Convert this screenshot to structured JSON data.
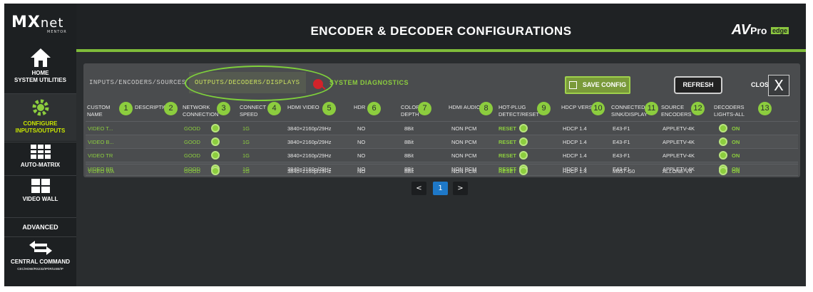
{
  "brand": {
    "logo_main": "MX",
    "logo_net": "net",
    "logo_sub": "MENTOR",
    "vendor": "AV",
    "vendor_pro": "Pro",
    "vendor_edge": "edge"
  },
  "title": "ENCODER & DECODER CONFIGURATIONS",
  "sidebar": {
    "items": [
      {
        "label": "HOME",
        "sub": "SYSTEM UTILITIES",
        "icon": "home-icon"
      },
      {
        "label": "CONFIGURE",
        "sub": "INPUTS/OUTPUTS",
        "icon": "gear-icon"
      },
      {
        "label": "AUTO-MATRIX",
        "icon": "matrix-grid-icon"
      },
      {
        "label": "VIDEO WALL",
        "icon": "video-wall-icon"
      },
      {
        "label": "ADVANCED"
      },
      {
        "label": "CENTRAL COMMAND",
        "sub": "CEC/HDMI/RS232/IP/IR/USB/IP",
        "icon": "arrows-icon"
      }
    ]
  },
  "tabs": [
    "INPUTS/ENCODERS/SOURCES",
    "OUTPUTS/DECODERS/DISPLAYS",
    "SYSTEM DIAGNOSTICS"
  ],
  "buttons": {
    "save": "SAVE CONFIG",
    "refresh": "REFRESH",
    "close_label": "CLOSE",
    "close_glyph": "X"
  },
  "columns": [
    {
      "label": "CUSTOM NAME",
      "num": "1"
    },
    {
      "label": "DESCRIPTION",
      "num": "2"
    },
    {
      "label": "NETWORK CONNECTION",
      "num": "3"
    },
    {
      "label": "CONNECT SPEED",
      "num": "4"
    },
    {
      "label": "HDMI VIDEO",
      "num": "5"
    },
    {
      "label": "HDR",
      "num": "6"
    },
    {
      "label": "COLOR DEPTH",
      "num": "7"
    },
    {
      "label": "HDMI AUDIO",
      "num": "8"
    },
    {
      "label": "HOT-PLUG DETECT/RESET",
      "num": "9"
    },
    {
      "label": "HDCP VERSION",
      "num": "10"
    },
    {
      "label": "CONNECTED SINK/DISPLAY",
      "num": "11"
    },
    {
      "label": "SOURCE ENCODERS",
      "num": "12"
    },
    {
      "label": "DECODERS LIGHTS-ALL",
      "num": "13"
    }
  ],
  "rows": [
    {
      "name": "VIDEO T...",
      "network": "GOOD",
      "speed": "1G",
      "video": "3840×2160p/29Hz",
      "hdr": "NO",
      "depth": "8Bit",
      "audio": "NON PCM",
      "hotplug": "RESET",
      "hdcp": "HDCP 1.4",
      "sink": "E43-F1",
      "source": "APPLETV-4K",
      "lights": "ON"
    },
    {
      "name": "VIDEO B...",
      "network": "GOOD",
      "speed": "1G",
      "video": "3840×2160p/29Hz",
      "hdr": "NO",
      "depth": "8Bit",
      "audio": "NON PCM",
      "hotplug": "RESET",
      "hdcp": "HDCP 1.4",
      "sink": "E43-F1",
      "source": "APPLETV-4K",
      "lights": "ON"
    },
    {
      "name": "VIDEO TR",
      "network": "GOOD",
      "speed": "1G",
      "video": "3840×2160p/29Hz",
      "hdr": "NO",
      "depth": "8Bit",
      "audio": "NON PCM",
      "hotplug": "RESET",
      "hdcp": "HDCP 1.4",
      "sink": "E43-F1",
      "source": "APPLETV-4K",
      "lights": "ON"
    },
    {
      "name": "VIDEO BR",
      "network": "GOOD",
      "speed": "1G",
      "video": "3840×2160p/29Hz",
      "hdr": "NO",
      "depth": "8Bit",
      "audio": "NON PCM",
      "hotplug": "RESET",
      "hdcp": "HDCP 1.4",
      "sink": "E43-F1",
      "source": "APPLETV-4K",
      "lights": "ON"
    },
    {
      "name": "VIDEO WA",
      "network": "GOOD",
      "speed": "1G",
      "video": "3840×2160p/29Hz",
      "hdr": "NO",
      "depth": "8Bit",
      "audio": "NON PCM",
      "hotplug": "RESET",
      "hdcp": "HDCP 1.4",
      "sink": "M657-G0",
      "source": "ALLONE-V6",
      "lights": "ON"
    }
  ],
  "pagination": {
    "prev": "<",
    "current": "1",
    "next": ">"
  },
  "colors": {
    "accent": "#8ccd3e",
    "active_tab": "#c9e05f",
    "page_current": "#1e78c8",
    "annotation": "#d2232a"
  }
}
